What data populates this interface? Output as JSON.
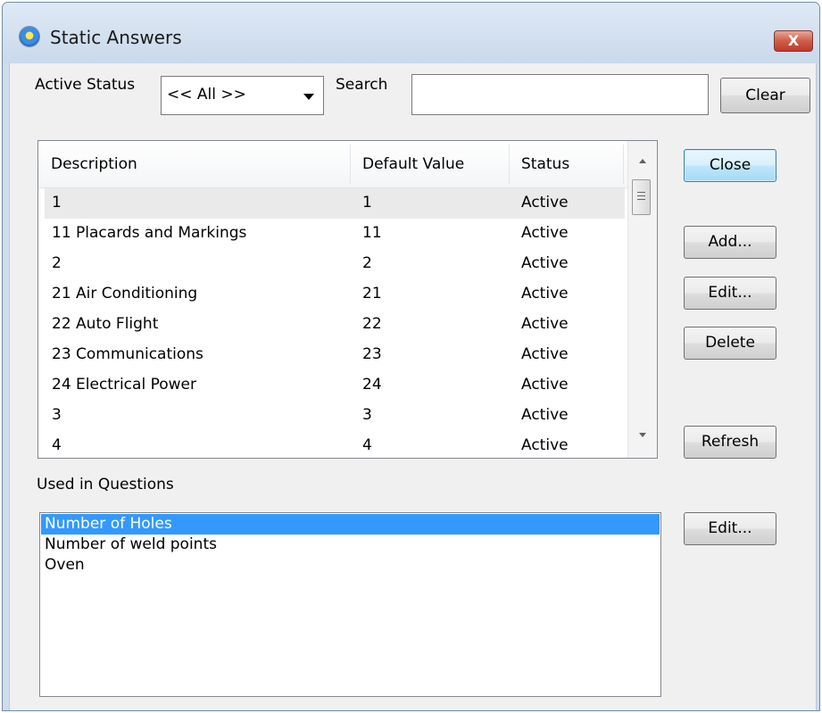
{
  "window": {
    "title": "Static Answers",
    "close_symbol": "X"
  },
  "filter": {
    "active_status_label": "Active Status",
    "active_status_value": "<< All >>",
    "search_label": "Search",
    "search_value": "",
    "clear_label": "Clear"
  },
  "answers_table": {
    "columns": [
      "Description",
      "Default Value",
      "Status"
    ],
    "rows": [
      {
        "description": "1",
        "default_value": "1",
        "status": "Active"
      },
      {
        "description": "11 Placards and Markings",
        "default_value": "11",
        "status": "Active"
      },
      {
        "description": "2",
        "default_value": "2",
        "status": "Active"
      },
      {
        "description": "21 Air Conditioning",
        "default_value": "21",
        "status": "Active"
      },
      {
        "description": "22 Auto Flight",
        "default_value": "22",
        "status": "Active"
      },
      {
        "description": "23 Communications",
        "default_value": "23",
        "status": "Active"
      },
      {
        "description": "24 Electrical Power",
        "default_value": "24",
        "status": "Active"
      },
      {
        "description": "3",
        "default_value": "3",
        "status": "Active"
      },
      {
        "description": "4",
        "default_value": "4",
        "status": "Active"
      }
    ]
  },
  "buttons": {
    "close": "Close",
    "add": "Add...",
    "edit": "Edit...",
    "delete": "Delete",
    "refresh": "Refresh",
    "questions_edit": "Edit..."
  },
  "used_in_questions": {
    "label": "Used in Questions",
    "items": [
      "Number of Holes",
      "Number of weld points",
      "Oven"
    ]
  }
}
